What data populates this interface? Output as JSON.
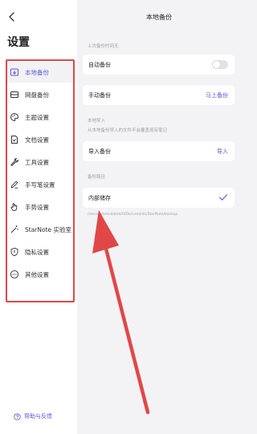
{
  "sidebar": {
    "title": "设置",
    "items": [
      {
        "label": "本地备份",
        "icon": "local-backup-icon",
        "active": true
      },
      {
        "label": "网盘备份",
        "icon": "cloud-drive-icon"
      },
      {
        "label": "主题设置",
        "icon": "palette-icon"
      },
      {
        "label": "文档设置",
        "icon": "document-icon"
      },
      {
        "label": "工具设置",
        "icon": "wrench-icon"
      },
      {
        "label": "手写笔设置",
        "icon": "stylus-icon"
      },
      {
        "label": "手势设置",
        "icon": "hand-gesture-icon"
      },
      {
        "label": "StarNote 实验室",
        "icon": "magic-wand-icon"
      },
      {
        "label": "隐私设置",
        "icon": "shield-icon"
      },
      {
        "label": "其他设置",
        "icon": "more-icon"
      }
    ],
    "help_label": "帮助与反馈"
  },
  "main": {
    "title": "本地备份",
    "last_backup_label": "上次备份时间无",
    "auto_backup_label": "自动备份",
    "auto_backup_on": false,
    "manual_backup_label": "手动备份",
    "manual_backup_action": "马上备份",
    "local_import_section": "本地导入",
    "local_import_note": "从本地备份导入的文件不会覆盖现有笔记",
    "import_label": "导入备份",
    "import_action": "导入",
    "backup_path_section": "备份路径",
    "internal_storage_label": "内部储存",
    "backup_path": "/storage/emulated/0/Documents/StarNote/backup"
  },
  "colors": {
    "accent": "#5b57d6",
    "annotation": "#e04848",
    "background": "#f3f3f6"
  }
}
